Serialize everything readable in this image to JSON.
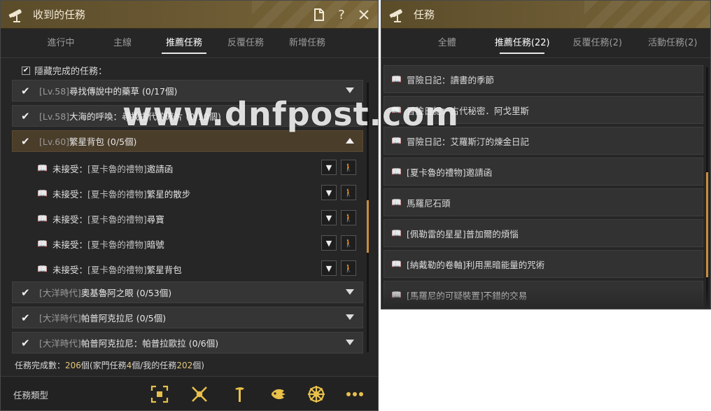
{
  "left_window": {
    "title": "收到的任務",
    "tabs": [
      {
        "label": "進行中"
      },
      {
        "label": "主線"
      },
      {
        "label": "推薦任務"
      },
      {
        "label": "反覆任務"
      },
      {
        "label": "新增任務"
      }
    ],
    "active_tab": "推薦任務",
    "hide_completed_label": "隱藏完成的任務：",
    "quests": [
      {
        "prefix": "[Lv.58]",
        "name": "尋找傳說中的藥草",
        "progress": "(0/17個)"
      },
      {
        "prefix": "[Lv.58]",
        "name": "大海的呼喚：尋找古代的碎片",
        "progress": "(0/10個)"
      },
      {
        "prefix": "[Lv.60]",
        "name": "繁星背包",
        "progress": "(0/5個)"
      },
      {
        "prefix": "[大洋時代]",
        "name": "奧基魯阿之眼",
        "progress": "(0/53個)"
      },
      {
        "prefix": "[大洋時代]",
        "name": "帕普阿克拉尼",
        "progress": "(0/5個)"
      },
      {
        "prefix": "[大洋時代]",
        "name": "帕普阿克拉尼：帕普拉歐拉",
        "progress": "(0/6個)"
      }
    ],
    "sub_quests": [
      {
        "status": "未接受：",
        "bracket": "[夏卡魯的禮物]",
        "name": "邀請函"
      },
      {
        "status": "未接受：",
        "bracket": "[夏卡魯的禮物]",
        "name": "繁星的散步"
      },
      {
        "status": "未接受：",
        "bracket": "[夏卡魯的禮物]",
        "name": "尋寶"
      },
      {
        "status": "未接受：",
        "bracket": "[夏卡魯的禮物]",
        "name": "暗號"
      },
      {
        "status": "未接受：",
        "bracket": "[夏卡魯的禮物]",
        "name": "繁星背包"
      }
    ],
    "summary": {
      "label": "任務完成數：",
      "total": "206",
      "unit": "個",
      "family_label": "(家門任務",
      "family": "4",
      "mine_label": "個/我的任務",
      "mine": "202",
      "end": "個)"
    },
    "quest_type_label": "任務類型",
    "category_icons": [
      "all-category-icon",
      "combat-category-icon",
      "gathering-category-icon",
      "fishing-category-icon",
      "sailing-category-icon",
      "more-icon"
    ]
  },
  "right_window": {
    "title": "任務",
    "tabs": [
      {
        "label": "全體"
      },
      {
        "label": "推薦任務(22)"
      },
      {
        "label": "反覆任務(2)"
      },
      {
        "label": "活動任務(2)"
      }
    ],
    "active_tab": "推薦任務(22)",
    "items": [
      {
        "label": "冒險日記：讀書的季節"
      },
      {
        "label": "冒險日記：古代秘密．阿戈里斯"
      },
      {
        "label": "冒險日記：艾羅斯汀的煉金日記"
      },
      {
        "label": "[夏卡魯的禮物]邀請函"
      },
      {
        "label": "馬羅尼石頭"
      },
      {
        "label": "[佩勒雷的星星]普加爾的煩惱"
      },
      {
        "label": "[納戴勒的卷軸]利用黑暗能量的咒術"
      },
      {
        "label": "[馬羅尼的可疑裝置]不錯的交易"
      }
    ]
  },
  "watermark": "www.dnfpost.com",
  "colors": {
    "title_gold": "#6b5a33",
    "accent_orange": "#c98d3d",
    "highlight_row": "#4a3d2a",
    "number_yellow": "#e3c77b"
  }
}
